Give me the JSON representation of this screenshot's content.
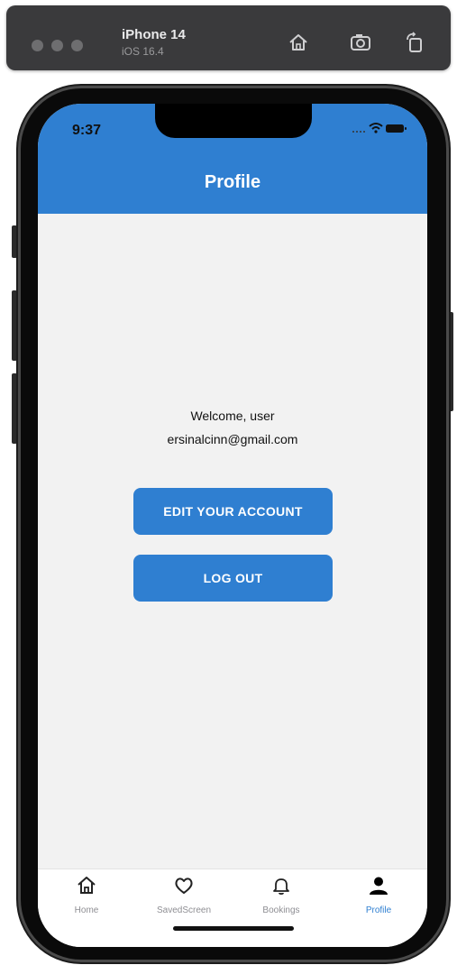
{
  "simulator": {
    "device_name": "iPhone 14",
    "os_version": "iOS 16.4",
    "buttons": [
      "home-icon",
      "screenshot-icon",
      "rotate-icon"
    ]
  },
  "status_bar": {
    "time": "9:37"
  },
  "header": {
    "title": "Profile"
  },
  "profile": {
    "welcome": "Welcome, user",
    "email": "ersinalcinn@gmail.com"
  },
  "actions": {
    "edit_account": "EDIT YOUR ACCOUNT",
    "logout": "LOG OUT"
  },
  "tabbar": {
    "active_index": 3,
    "active_color": "#2f7fd1",
    "items": [
      {
        "label": "Home",
        "icon": "home-icon"
      },
      {
        "label": "SavedScreen",
        "icon": "heart-icon"
      },
      {
        "label": "Bookings",
        "icon": "bell-icon"
      },
      {
        "label": "Profile",
        "icon": "person-icon"
      }
    ]
  },
  "colors": {
    "accent": "#2f7fd1",
    "background": "#f2f2f2"
  }
}
